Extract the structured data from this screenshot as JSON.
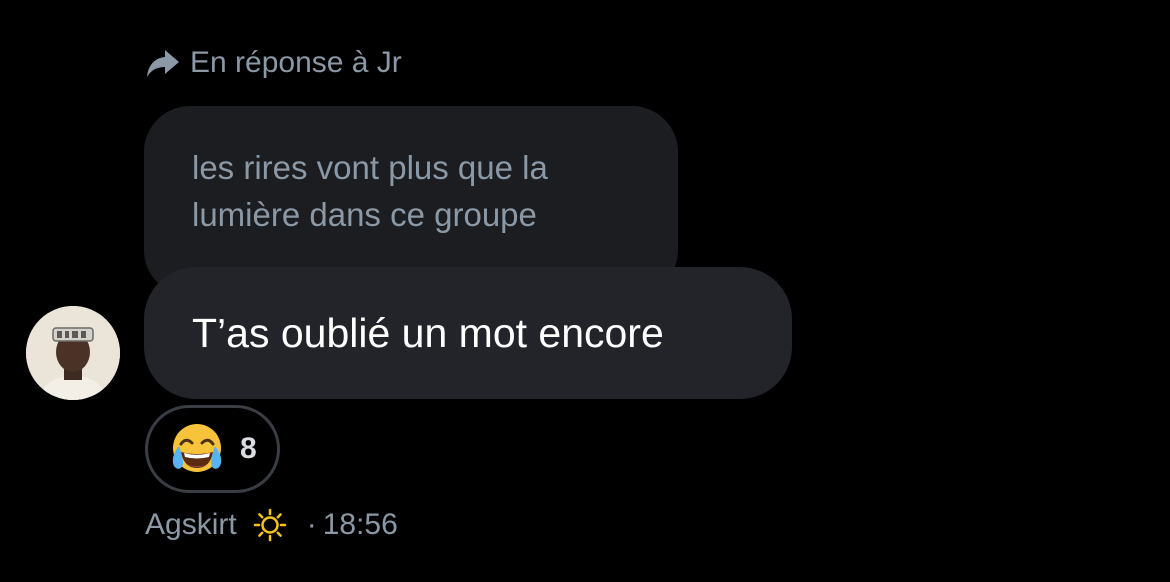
{
  "reply_header": {
    "icon": "reply-arrow-icon",
    "text": "En réponse à Jr"
  },
  "quoted_message": {
    "text": "les rires vont plus que la lumière dans ce groupe"
  },
  "message": {
    "text": "T’as oublié un mot encore"
  },
  "reaction": {
    "emoji": "face-with-tears-of-joy",
    "count": "8"
  },
  "meta": {
    "sender": "Agskirt",
    "status_icon": "sun-icon",
    "separator": "·",
    "time": "18:56"
  },
  "colors": {
    "background": "#000000",
    "bubble_quoted": "#1b1d21",
    "bubble_message": "#222429",
    "muted_text": "#8b98a5",
    "sun": "#f5c518"
  }
}
